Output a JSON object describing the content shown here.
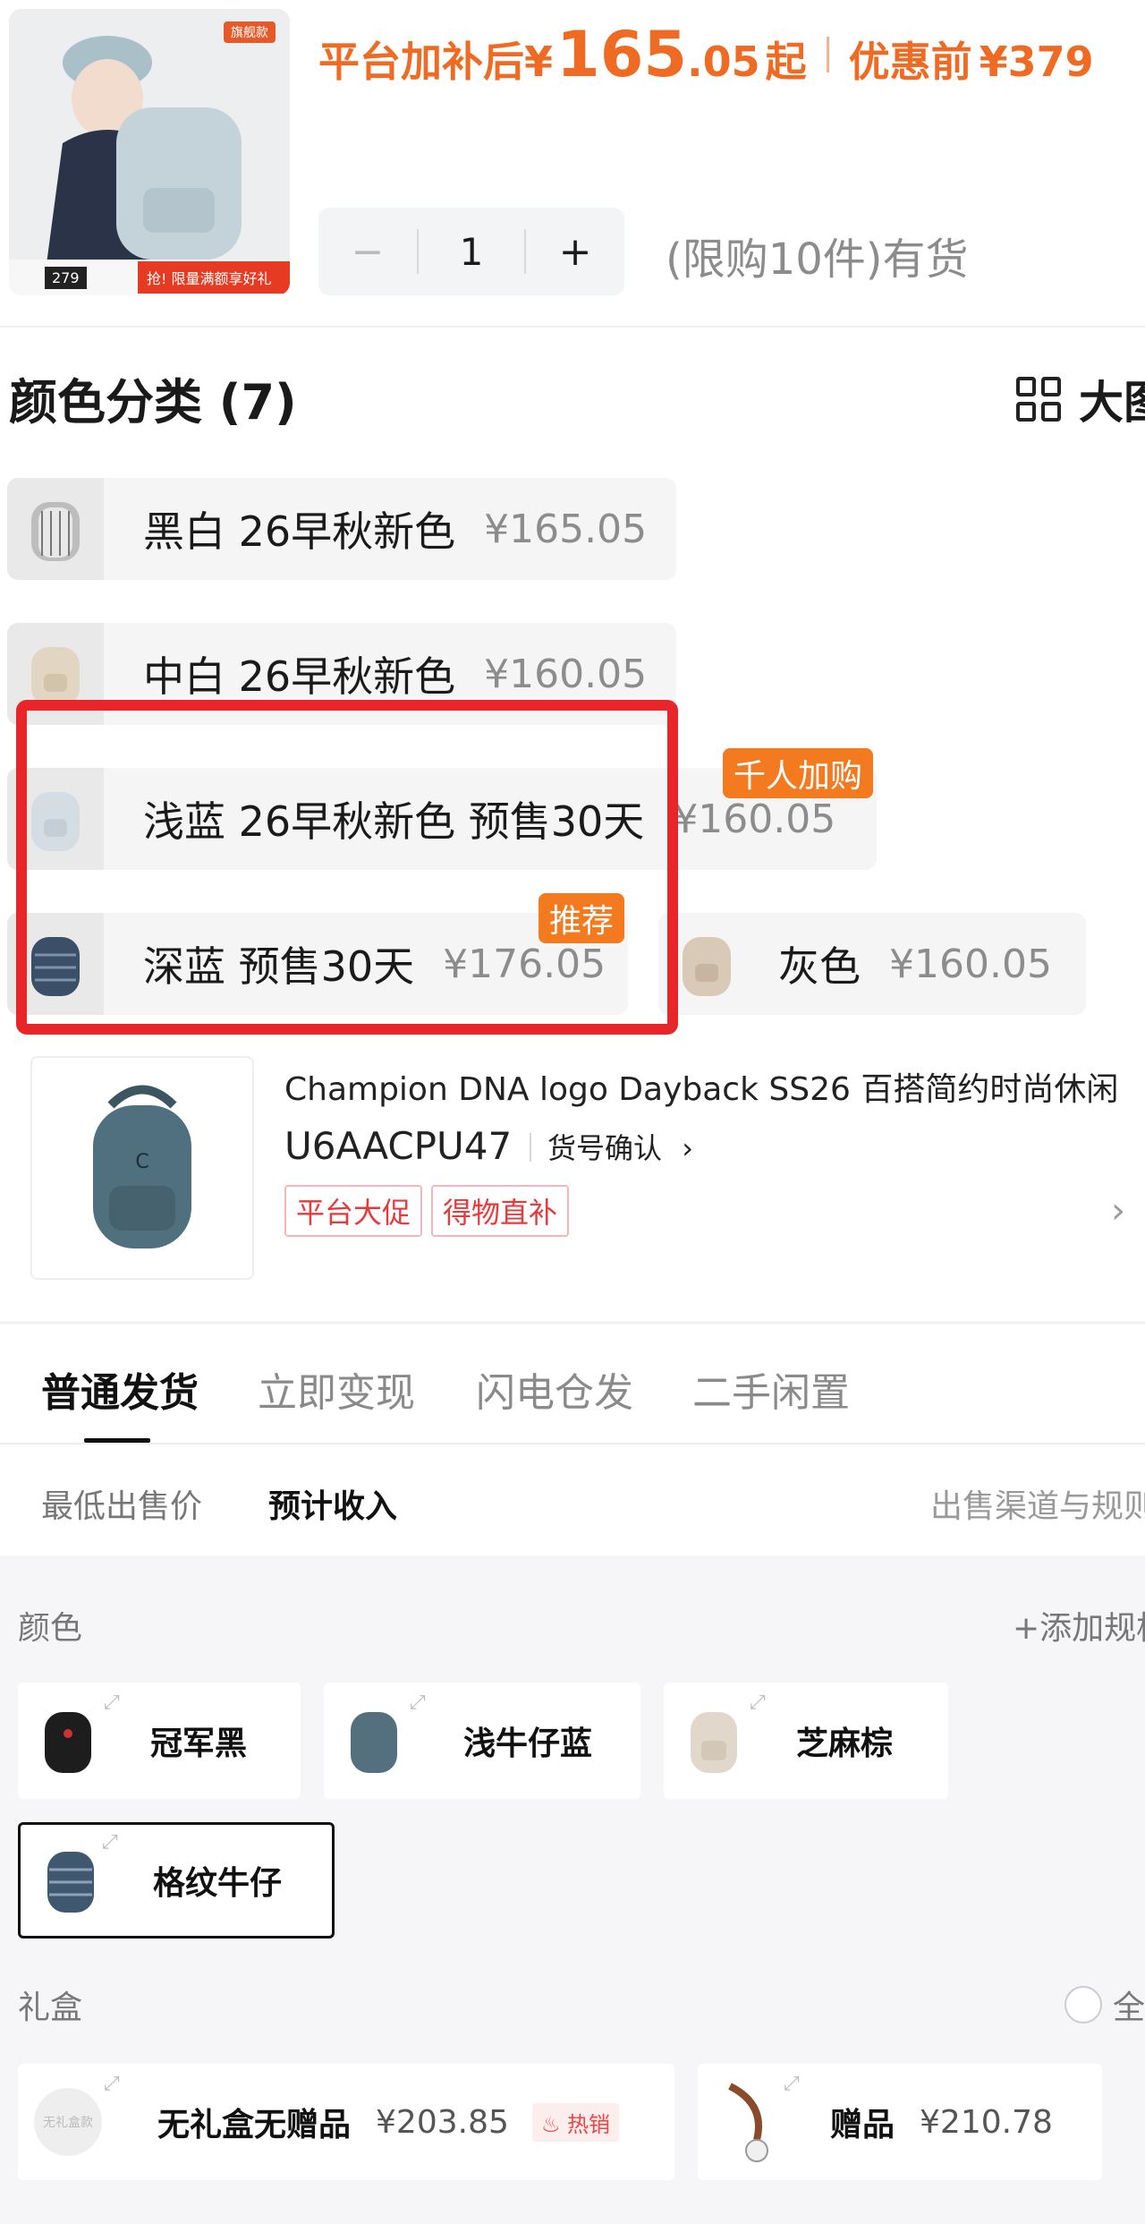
{
  "product": {
    "thumb_badge": "旗舰款",
    "thumb_price": "279",
    "thumb_promo": "抢! 限量满额享好礼",
    "price_label": "平台加补后",
    "price_currency": "¥",
    "price_int": "165",
    "price_dec": ".05",
    "price_suffix": "起",
    "original_label": "优惠前",
    "original_price": "¥379",
    "quantity": "1",
    "minus": "−",
    "plus": "+",
    "stock": "(限购10件)有货"
  },
  "color_section": {
    "title": "颜色分类 (7)",
    "big_view": "大图",
    "items": [
      {
        "name": "黑白 26早秋新色",
        "price": "¥165.05"
      },
      {
        "name": "中白 26早秋新色",
        "price": "¥160.05"
      },
      {
        "name": "浅蓝 26早秋新色 预售30天",
        "price": "¥160.05",
        "tag": "千人加购"
      },
      {
        "name": "深蓝 预售30天",
        "price": "¥176.05",
        "tag": "推荐"
      },
      {
        "name": "灰色",
        "price": "¥160.05"
      }
    ]
  },
  "card": {
    "title": "Champion DNA logo Dayback SS26 百搭简约时尚休闲",
    "model": "U6AACPU47",
    "verify": "货号确认",
    "pills": [
      "平台大促",
      "得物直补"
    ]
  },
  "tabs": [
    "普通发货",
    "立即变现",
    "闪电仓发",
    "二手闲置"
  ],
  "subtabs": {
    "lowest": "最低出售价",
    "income": "预计收入",
    "rules": "出售渠道与规则"
  },
  "spec": {
    "color_label": "颜色",
    "add_spec": "+添加规格",
    "colors": [
      "冠军黑",
      "浅牛仔蓝",
      "芝麻棕",
      "格纹牛仔"
    ],
    "giftbox_label": "礼盒",
    "select_all": "全选",
    "giftboxes": [
      {
        "name": "无礼盒无赠品",
        "price": "¥203.85",
        "hot": "热销",
        "img_text": "无礼盒款"
      },
      {
        "name": "赠品",
        "price": "¥210.78"
      }
    ]
  }
}
